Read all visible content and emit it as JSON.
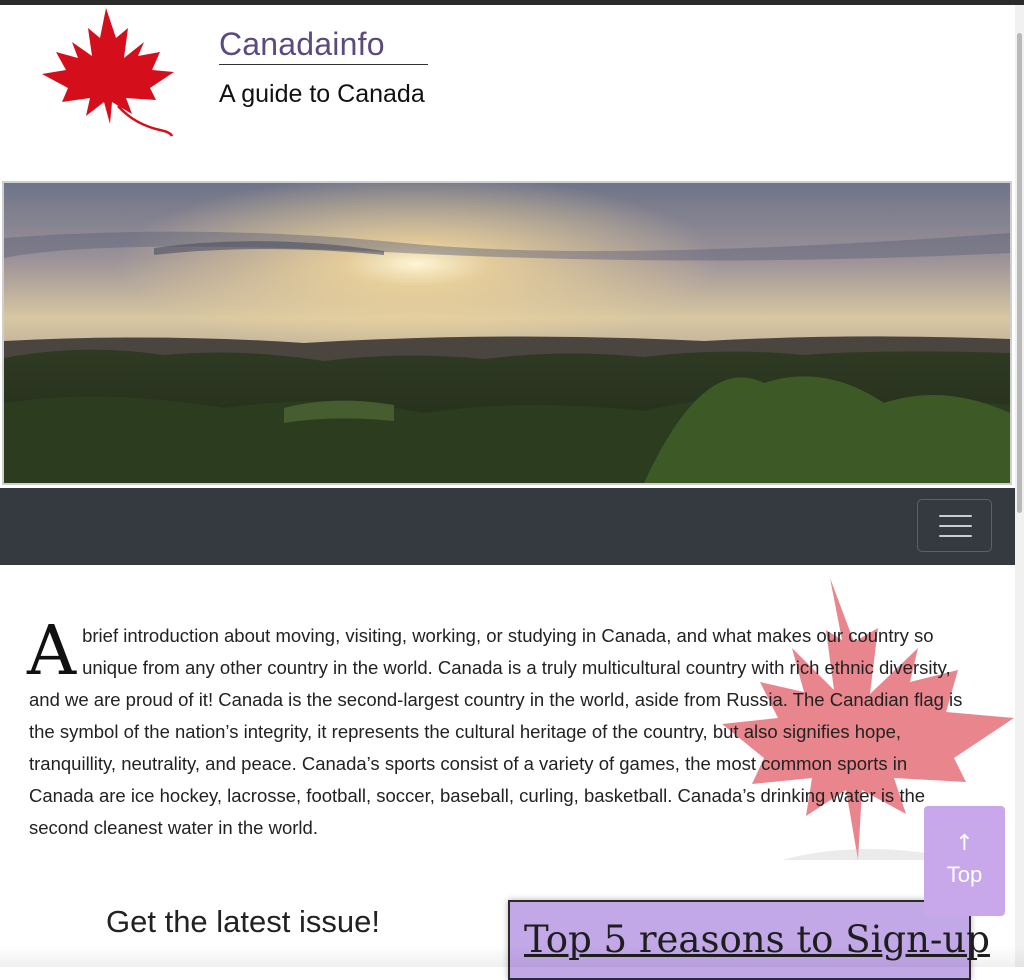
{
  "header": {
    "site_title": "Canadainfo",
    "tagline": "A guide to Canada",
    "logo_icon": "maple-leaf-icon"
  },
  "hero": {
    "scene": "sunset-over-forest-photo"
  },
  "navbar": {
    "toggle_icon": "hamburger-menu-icon"
  },
  "intro": {
    "drop_cap": "A",
    "text": " brief introduction about moving, visiting, working, or studying in Canada, and what makes our country so unique from any other country in the world. Canada is a truly multicultural country with rich ethnic diversity, and we are proud of it! Canada is the second-largest country in the world, aside from Russia. The Canadian flag is the symbol of the nation’s integrity, it represents the cultural heritage of the country, but also signifies hope, tranquillity, neutrality, and peace. Canada’s sports consist of a variety of games, the most common sports in Canada are ice hockey, lacrosse, football, soccer, baseball, curling, basketball. Canada’s drinking water is the second cleanest water in the world."
  },
  "signup": {
    "latest_heading": "Get the latest issue!",
    "reasons_link": "Top 5 reasons to Sign-up"
  },
  "back_to_top": {
    "icon": "arrow-up-icon",
    "label": "Top"
  },
  "colors": {
    "brand_title": "#5b4a7e",
    "navbar": "#343a40",
    "leaf_red": "#d0021b",
    "accent_purple": "#c3a8e8"
  }
}
